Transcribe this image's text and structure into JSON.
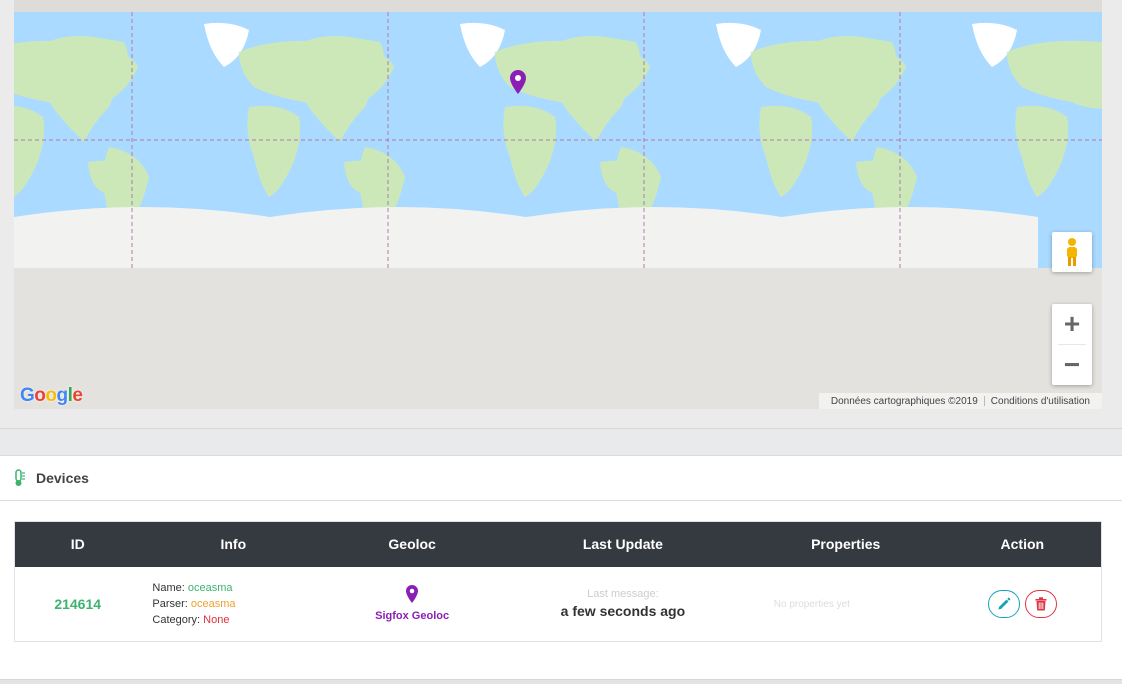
{
  "map": {
    "attribution_data": "Données cartographiques ©2019",
    "attribution_terms": "Conditions d'utilisation",
    "google_logo": "Google",
    "zoom_in_label": "+",
    "zoom_out_label": "−",
    "marker_color": "#8a1fb5"
  },
  "devices_panel": {
    "title": "Devices",
    "icon": "thermometer-icon",
    "columns": [
      "ID",
      "Info",
      "Geoloc",
      "Last Update",
      "Properties",
      "Action"
    ],
    "rows": [
      {
        "id": "214614",
        "name_label": "Name: ",
        "name_value": "oceasma",
        "parser_label": "Parser: ",
        "parser_value": "oceasma",
        "category_label": "Category: ",
        "category_value": "None",
        "geoloc_label": "Sigfox Geoloc",
        "last_message_label": "Last message:",
        "last_message_value": "a few seconds ago",
        "properties_text": "No properties yet"
      }
    ]
  },
  "colors": {
    "header_dark": "#343a40",
    "green": "#3cb371",
    "orange": "#f0a030",
    "red": "#e0303f",
    "purple": "#8a1fb5",
    "edit": "#17a2b8",
    "delete": "#dc3545"
  }
}
